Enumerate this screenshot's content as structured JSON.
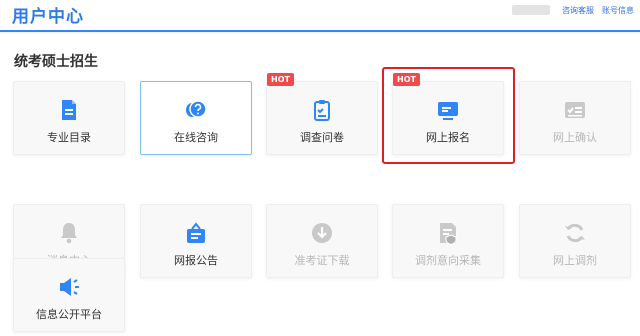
{
  "header": {
    "title": "用户中心",
    "links": [
      "咨询客服",
      "账号信息"
    ]
  },
  "section": {
    "title": "统考硕士招生"
  },
  "badge": "HOT",
  "colors": {
    "accent": "#2f86f6",
    "hot": "#ef4b4b",
    "highlight": "#e02020",
    "disabled": "#c9c9c9"
  },
  "tiles": [
    {
      "label": "专业目录",
      "icon": "document-icon",
      "state": "enabled"
    },
    {
      "label": "在线咨询",
      "icon": "chat-question-icon",
      "state": "selected"
    },
    {
      "label": "调查问卷",
      "icon": "clipboard-check-icon",
      "state": "enabled",
      "hot": true
    },
    {
      "label": "网上报名",
      "icon": "monitor-icon",
      "state": "enabled",
      "hot": true,
      "highlighted": true
    },
    {
      "label": "网上确认",
      "icon": "id-card-icon",
      "state": "disabled"
    },
    {
      "label": "消息中心",
      "icon": "bell-icon",
      "state": "disabled"
    },
    {
      "label": "网报公告",
      "icon": "notice-box-icon",
      "state": "enabled"
    },
    {
      "label": "准考证下载",
      "icon": "download-icon",
      "state": "disabled"
    },
    {
      "label": "调剂意向采集",
      "icon": "file-shield-icon",
      "state": "disabled"
    },
    {
      "label": "网上调剂",
      "icon": "refresh-icon",
      "state": "disabled"
    },
    {
      "label": "信息公开平台",
      "icon": "megaphone-icon",
      "state": "enabled"
    }
  ]
}
